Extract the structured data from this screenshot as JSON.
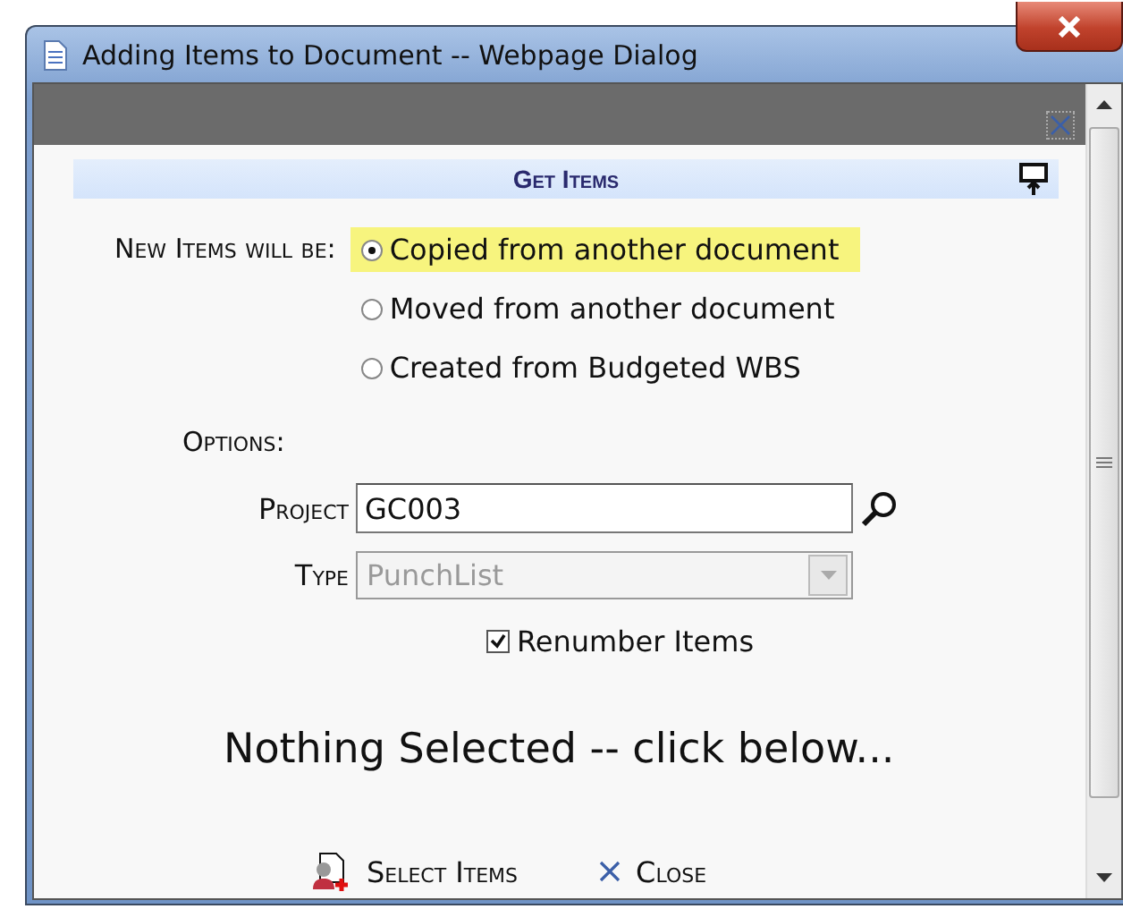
{
  "window": {
    "title": "Adding Items to Document -- Webpage Dialog"
  },
  "header": {
    "title": "Get Items"
  },
  "mode": {
    "label": "New Items will be:",
    "options": [
      {
        "label": "Copied from another document",
        "selected": true
      },
      {
        "label": "Moved from another document",
        "selected": false
      },
      {
        "label": "Created from Budgeted WBS",
        "selected": false
      }
    ]
  },
  "options": {
    "label": "Options:",
    "project": {
      "label": "Project",
      "value": "GC003"
    },
    "type": {
      "label": "Type",
      "value": "PunchList",
      "disabled": true
    },
    "renumber": {
      "label": "Renumber Items",
      "checked": true
    }
  },
  "status": "Nothing Selected -- click below...",
  "buttons": [
    {
      "kind": "select",
      "label": "Select Items"
    },
    {
      "kind": "close",
      "label": "Close"
    }
  ]
}
